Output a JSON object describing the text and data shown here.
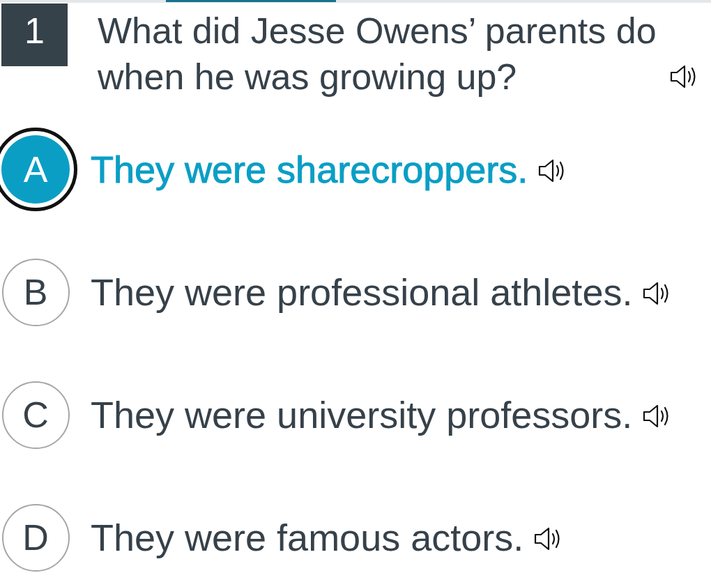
{
  "question": {
    "number": "1",
    "text": "What did Jesse Owens’ parents do when he was growing up?"
  },
  "options": [
    {
      "letter": "A",
      "text": "They were sharecroppers.",
      "selected": true,
      "focused": true
    },
    {
      "letter": "B",
      "text": "They were professional athletes.",
      "selected": false,
      "focused": false
    },
    {
      "letter": "C",
      "text": "They were university professors.",
      "selected": false,
      "focused": false
    },
    {
      "letter": "D",
      "text": "They were famous actors.",
      "selected": false,
      "focused": false
    }
  ]
}
